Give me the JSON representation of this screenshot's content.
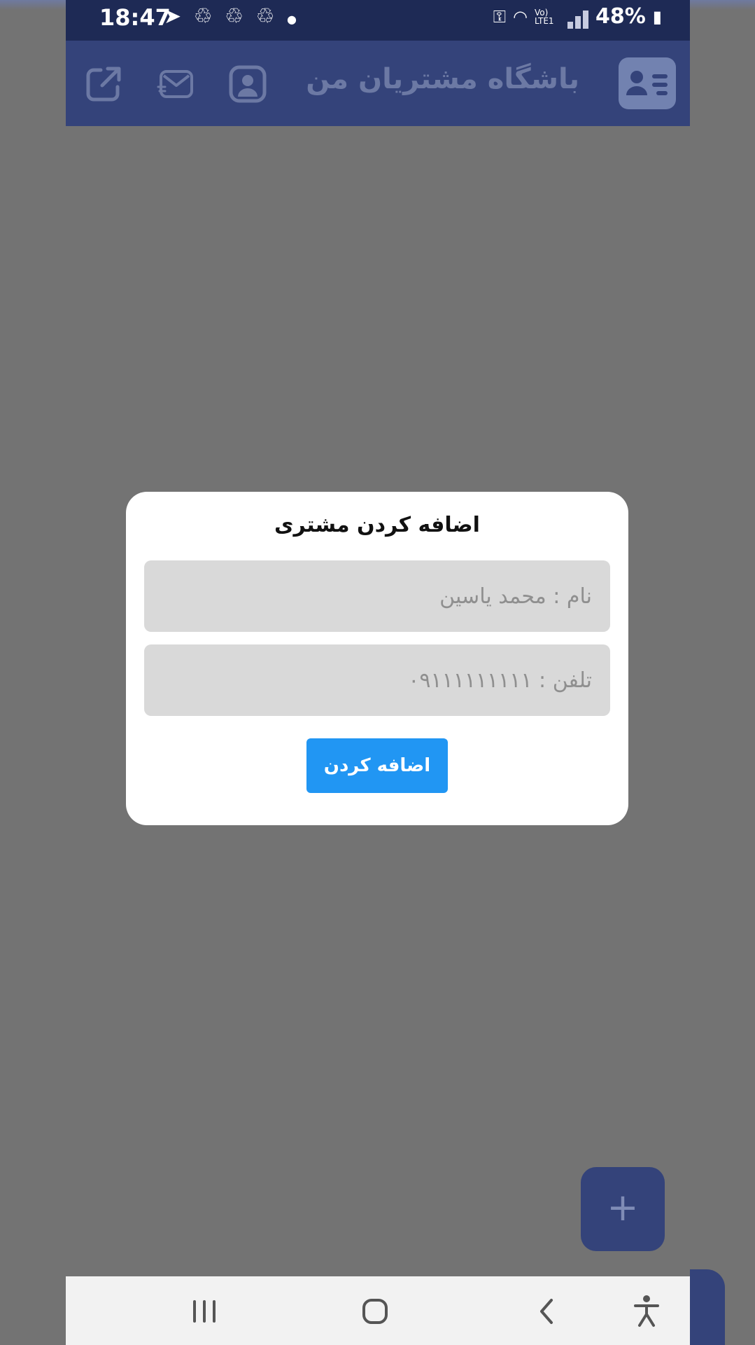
{
  "status_bar": {
    "time": "18:47",
    "left_icons": [
      "telegram-icon",
      "recycle-icon",
      "recycle-icon",
      "recycle-icon",
      "dot-icon"
    ],
    "network_label": "Vo) LTE1",
    "battery": "48%"
  },
  "app_bar": {
    "title": "باشگاه مشتریان من",
    "actions": [
      "share-icon",
      "message-icon",
      "profile-icon"
    ],
    "logo": "contact-card-icon",
    "background": "#34437a"
  },
  "dialog": {
    "title": "اضافه کردن مشتری",
    "name_placeholder": "نام : محمد یاسین",
    "name_value": "",
    "phone_placeholder": "تلفن : ۰۹۱۱۱۱۱۱۱۱۱",
    "phone_value": "",
    "submit_label": "اضافه کردن",
    "submit_color": "#2196f3"
  },
  "fab": {
    "label": "+",
    "color": "#34437a"
  },
  "nav_bar": {
    "buttons": [
      "recents-icon",
      "home-icon",
      "back-icon",
      "accessibility-icon"
    ]
  }
}
